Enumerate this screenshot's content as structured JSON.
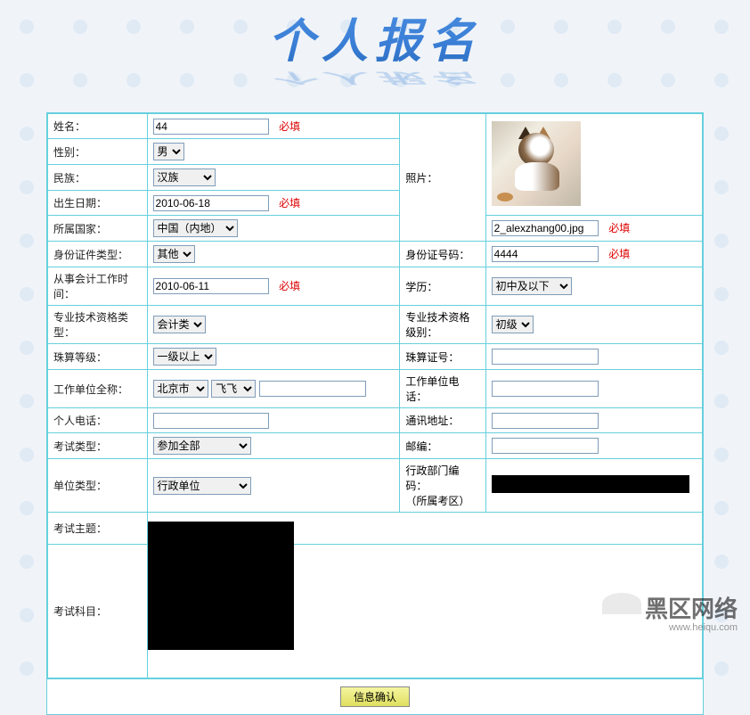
{
  "title": "个人报名",
  "required_text": "必填",
  "labels": {
    "name": "姓名：",
    "gender": "性别：",
    "ethnicity": "民族：",
    "birth": "出生日期：",
    "country": "所属国家：",
    "id_type": "身份证件类型：",
    "work_date": "从事会计工作时间：",
    "pro_qual_type": "专业技术资格类型：",
    "abacus_level": "珠算等级：",
    "employer": "工作单位全称：",
    "personal_phone": "个人电话：",
    "exam_type": "考试类型：",
    "unit_type": "单位类型：",
    "exam_topic": "考试主题：",
    "exam_subject": "考试科目：",
    "photo": "照片：",
    "id_number": "身份证号码：",
    "education": "学历：",
    "pro_qual_level": "专业技术资格级别：",
    "abacus_cert": "珠算证号：",
    "employer_phone": "工作单位电话：",
    "address": "通讯地址：",
    "postcode": "邮编：",
    "admin_code": "行政部门编码：\n（所属考区）"
  },
  "values": {
    "name": "44",
    "gender": "男",
    "ethnicity": "汉族",
    "birth": "2010-06-18",
    "country": "中国（内地）",
    "id_type": "其他",
    "work_date": "2010-06-11",
    "pro_qual_type": "会计类",
    "abacus_level": "一级以上",
    "employer_city": "北京市",
    "employer_district": "飞飞",
    "employer_name": "",
    "personal_phone": "",
    "exam_type": "参加全部",
    "unit_type": "行政单位",
    "photo_filename": "2_alexzhang00.jpg",
    "id_number": "4444",
    "education": "初中及以下",
    "pro_qual_level": "初级",
    "abacus_cert": "",
    "employer_phone": "",
    "address": "",
    "postcode": ""
  },
  "submit_label": "信息确认",
  "watermark": {
    "main": "黑区网络",
    "sub": "www.heiqu.com"
  }
}
